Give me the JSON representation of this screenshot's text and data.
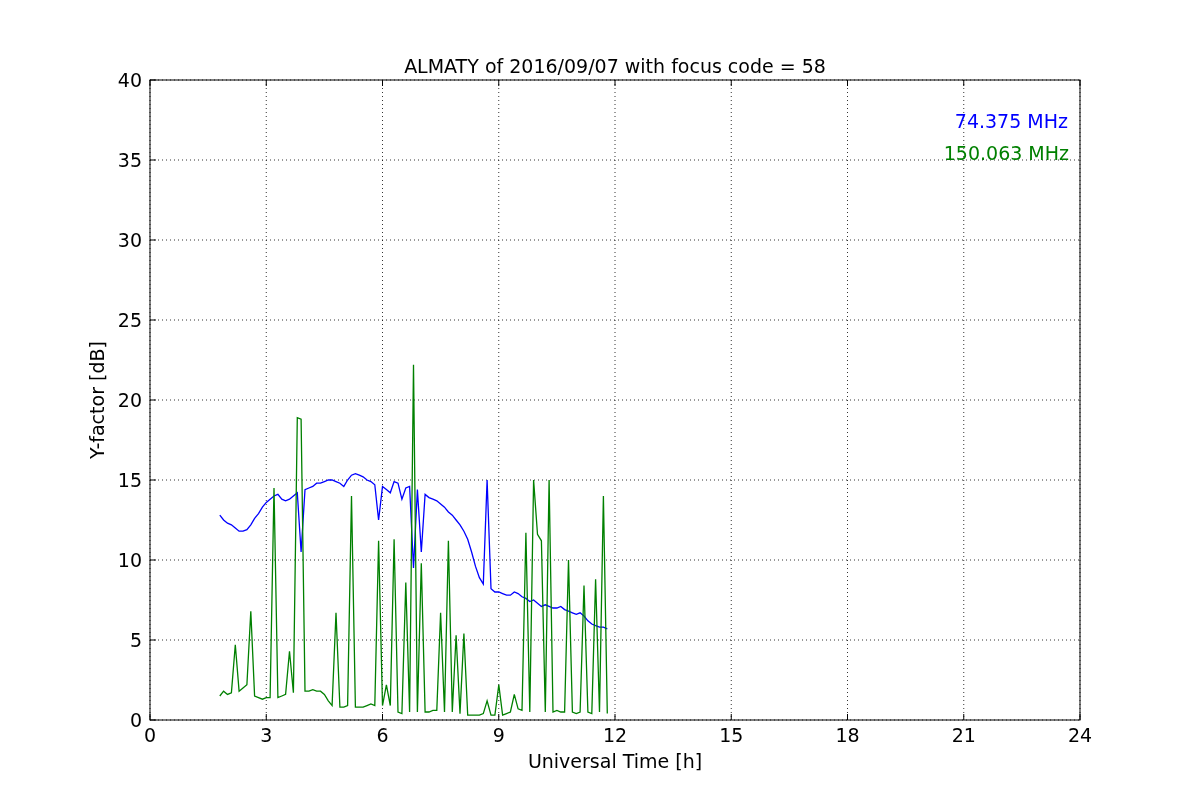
{
  "figure": {
    "chart_data": {
      "type": "line",
      "title": "ALMATY of 2016/09/07 with focus code = 58",
      "xlabel": "Universal Time [h]",
      "ylabel": "Y-factor [dB]",
      "xlim": [
        0,
        24
      ],
      "ylim": [
        0,
        40
      ],
      "xticks": [
        0,
        3,
        6,
        9,
        12,
        15,
        18,
        21,
        24
      ],
      "yticks": [
        0,
        5,
        10,
        15,
        20,
        25,
        30,
        35,
        40
      ],
      "grid": true,
      "x": [
        1.8,
        1.9,
        2.0,
        2.1,
        2.2,
        2.3,
        2.4,
        2.5,
        2.6,
        2.7,
        2.8,
        2.9,
        3.0,
        3.1,
        3.2,
        3.3,
        3.4,
        3.5,
        3.6,
        3.7,
        3.8,
        3.9,
        4.0,
        4.1,
        4.2,
        4.3,
        4.4,
        4.5,
        4.6,
        4.7,
        4.8,
        4.9,
        5.0,
        5.1,
        5.2,
        5.3,
        5.4,
        5.5,
        5.6,
        5.7,
        5.8,
        5.9,
        6.0,
        6.1,
        6.2,
        6.3,
        6.4,
        6.5,
        6.6,
        6.7,
        6.8,
        6.9,
        7.0,
        7.1,
        7.2,
        7.3,
        7.4,
        7.5,
        7.6,
        7.7,
        7.8,
        7.9,
        8.0,
        8.1,
        8.2,
        8.3,
        8.4,
        8.5,
        8.6,
        8.7,
        8.8,
        8.9,
        9.0,
        9.1,
        9.2,
        9.3,
        9.4,
        9.5,
        9.6,
        9.7,
        9.8,
        9.9,
        10.0,
        10.1,
        10.2,
        10.3,
        10.4,
        10.5,
        10.6,
        10.7,
        10.8,
        10.9,
        11.0,
        11.1,
        11.2,
        11.3,
        11.4,
        11.5,
        11.6,
        11.7,
        11.8
      ],
      "series": [
        {
          "name": "74.375 MHz",
          "color": "#0000ff",
          "values": [
            12.8,
            12.5,
            12.3,
            12.2,
            12.0,
            11.8,
            11.8,
            11.9,
            12.2,
            12.6,
            12.9,
            13.3,
            13.6,
            13.8,
            14.0,
            14.1,
            13.8,
            13.7,
            13.8,
            14.0,
            14.2,
            10.5,
            14.4,
            14.5,
            14.6,
            14.8,
            14.8,
            14.9,
            15.0,
            15.0,
            14.9,
            14.8,
            14.6,
            15.0,
            15.3,
            15.4,
            15.3,
            15.2,
            15.0,
            14.9,
            14.7,
            12.5,
            14.6,
            14.4,
            14.2,
            14.9,
            14.8,
            13.8,
            14.5,
            14.6,
            9.5,
            14.4,
            10.5,
            14.1,
            13.9,
            13.8,
            13.7,
            13.5,
            13.3,
            13.0,
            12.8,
            12.5,
            12.2,
            11.8,
            11.3,
            10.5,
            9.6,
            8.9,
            8.5,
            15.0,
            8.2,
            8.0,
            8.0,
            7.9,
            7.8,
            7.8,
            8.0,
            7.9,
            7.7,
            7.6,
            7.4,
            7.5,
            7.3,
            7.1,
            7.2,
            7.1,
            7.0,
            7.0,
            7.1,
            6.9,
            6.8,
            6.7,
            6.6,
            6.7,
            6.5,
            6.2,
            6.0,
            5.9,
            5.8,
            5.8,
            5.7
          ]
        },
        {
          "name": "150.063 MHz",
          "color": "#008000",
          "values": [
            1.5,
            1.8,
            1.6,
            1.7,
            4.7,
            1.8,
            2.0,
            2.2,
            6.8,
            1.5,
            1.4,
            1.3,
            1.4,
            1.4,
            14.5,
            1.4,
            1.5,
            1.6,
            4.3,
            1.7,
            18.9,
            18.8,
            1.8,
            1.8,
            1.9,
            1.8,
            1.8,
            1.6,
            1.2,
            0.9,
            6.7,
            0.8,
            0.8,
            0.9,
            14.0,
            0.8,
            0.8,
            0.8,
            0.9,
            1.0,
            0.9,
            11.2,
            0.9,
            2.2,
            0.9,
            11.3,
            0.5,
            0.4,
            8.6,
            0.5,
            22.2,
            0.5,
            9.8,
            0.5,
            0.5,
            0.6,
            0.6,
            6.7,
            0.5,
            11.2,
            0.5,
            5.3,
            0.4,
            5.4,
            0.3,
            0.3,
            0.3,
            0.3,
            0.4,
            1.2,
            0.3,
            0.3,
            2.2,
            0.3,
            0.4,
            0.5,
            1.6,
            0.7,
            0.6,
            11.7,
            0.5,
            15.0,
            11.6,
            11.2,
            0.5,
            15.0,
            0.5,
            0.6,
            0.5,
            0.5,
            10.0,
            0.5,
            0.4,
            0.5,
            8.4,
            0.5,
            0.4,
            8.8,
            0.5,
            14.0,
            0.4
          ]
        }
      ]
    }
  }
}
